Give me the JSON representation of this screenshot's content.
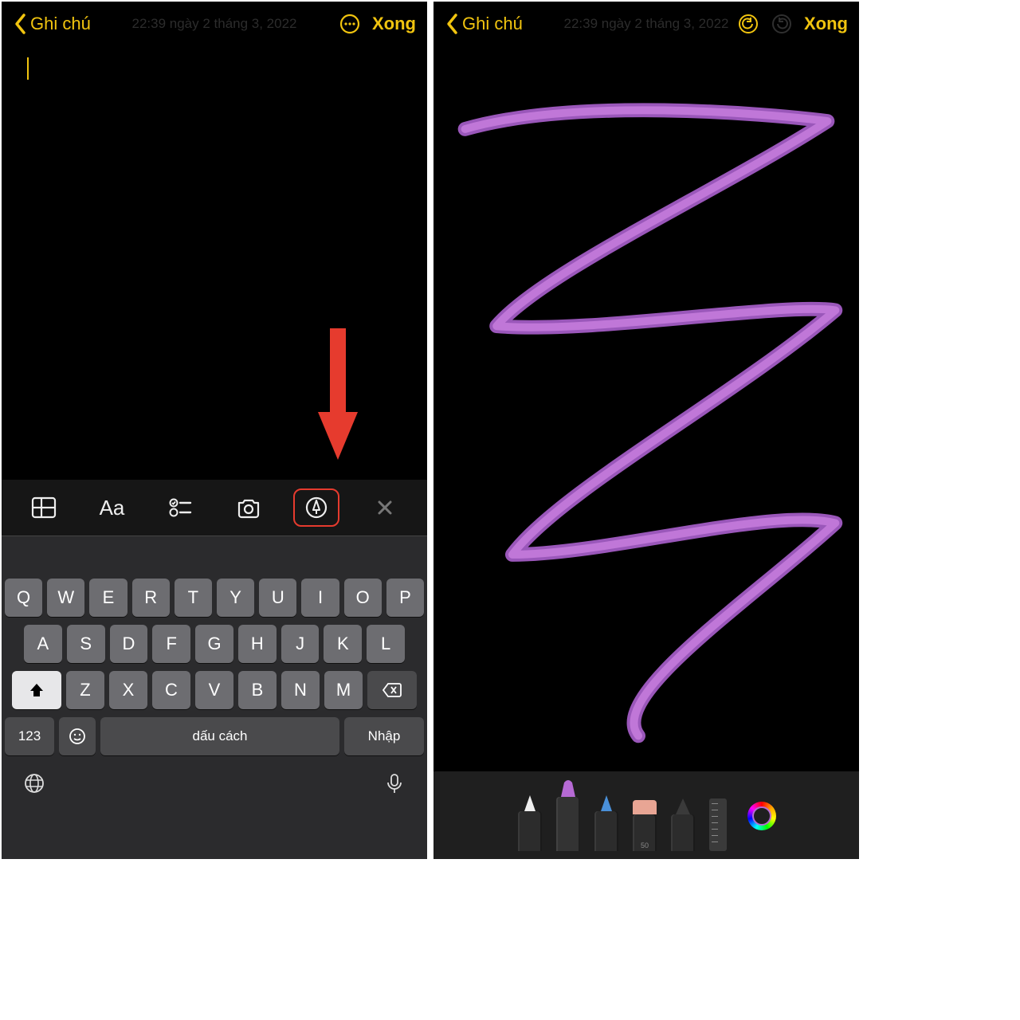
{
  "left": {
    "header": {
      "back": "Ghi chú",
      "done": "Xong"
    },
    "ghost_date": "22:39 ngày 2 tháng 3, 2022",
    "toolbar": {
      "table": "table-icon",
      "format": "Aa",
      "checklist": "checklist-icon",
      "camera": "camera-icon",
      "markup": "markup-icon",
      "close": "✕"
    },
    "keyboard": {
      "row1": [
        "Q",
        "W",
        "E",
        "R",
        "T",
        "Y",
        "U",
        "I",
        "O",
        "P"
      ],
      "row2": [
        "A",
        "S",
        "D",
        "F",
        "G",
        "H",
        "J",
        "K",
        "L"
      ],
      "row3": [
        "Z",
        "X",
        "C",
        "V",
        "B",
        "N",
        "M"
      ],
      "k123": "123",
      "space": "dấu cách",
      "enter": "Nhập"
    }
  },
  "right": {
    "header": {
      "back": "Ghi chú",
      "done": "Xong"
    },
    "ghost_date": "22:39 ngày 2 tháng 3, 2022",
    "tools": {
      "pen_label": "",
      "eraser_label": "50"
    }
  },
  "colors": {
    "accent": "#f1c40f",
    "annotation": "#e63b2e",
    "stroke": "#b66ad4"
  }
}
